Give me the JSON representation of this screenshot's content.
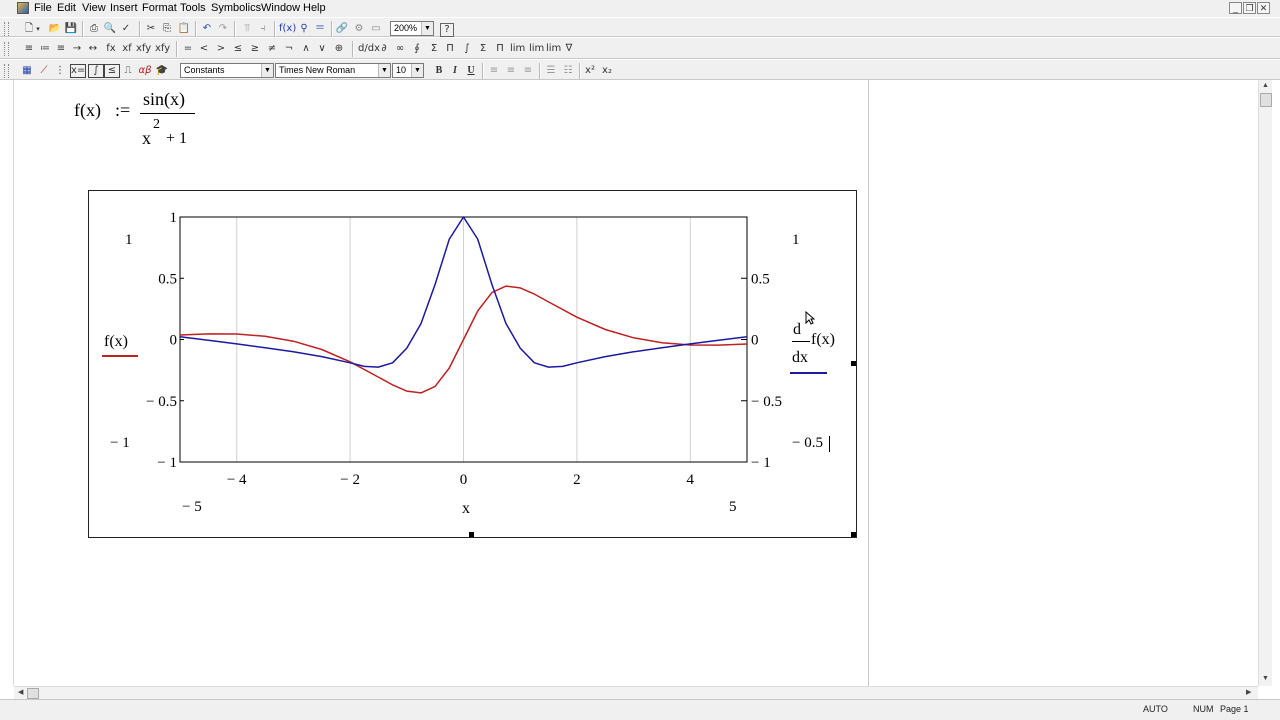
{
  "menu": {
    "items": [
      "File",
      "Edit",
      "View",
      "Insert",
      "Format",
      "Tools",
      "Symbolics",
      "Window",
      "Help"
    ]
  },
  "toolbar": {
    "zoom": "200%",
    "style": "Constants",
    "font": "Times New Roman",
    "size": "10",
    "bold": "B",
    "italic": "I",
    "underline": "U",
    "superscript": "x²",
    "subscript": "x₂"
  },
  "math_toolbar": {
    "symbols": [
      "=",
      "<",
      ">",
      "≤",
      "≥",
      "≠",
      "¬",
      "∧",
      "∨",
      "⊕",
      "∫",
      "Σ",
      "Π",
      "∇"
    ]
  },
  "definition": {
    "lhs": "f(x)",
    "assign": ":=",
    "numerator": "sin(x)",
    "denominator_base": "x",
    "denominator_exp": "2",
    "denominator_rest": "+ 1"
  },
  "plot": {
    "y_axis_top": "1",
    "y_axis_bottom": "− 1",
    "y2_axis_top": "1",
    "y2_axis_bottom": "− 0.5",
    "x_axis_left": "− 5",
    "x_axis_right": "5",
    "x_label": "x",
    "left_trace": "f(x)",
    "right_trace_d": "d",
    "right_trace_dx": "dx",
    "right_trace_f": "f(x)"
  },
  "chart_data": {
    "type": "line",
    "title": "",
    "xlabel": "x",
    "ylabel": "f(x)",
    "y2label": "d/dx f(x)",
    "xlim": [
      -5,
      5
    ],
    "ylim": [
      -1,
      1
    ],
    "y2lim": [
      -1,
      1
    ],
    "x_ticks": [
      "− 4",
      "− 2",
      "0",
      "2",
      "4"
    ],
    "y_ticks": [
      "1",
      "0.5",
      "0",
      "− 0.5",
      "− 1"
    ],
    "y2_ticks": [
      "0.5",
      "0",
      "− 0.5",
      "− 1"
    ],
    "series": [
      {
        "name": "f(x)",
        "color": "#c02020",
        "axis": "left",
        "x": [
          -5,
          -4.5,
          -4,
          -3.5,
          -3,
          -2.5,
          -2,
          -1.5,
          -1.25,
          -1,
          -0.75,
          -0.5,
          -0.25,
          0,
          0.25,
          0.5,
          0.75,
          1,
          1.25,
          1.5,
          2,
          2.5,
          3,
          3.5,
          4,
          4.5,
          5
        ],
        "y": [
          0.037,
          0.046,
          0.045,
          0.026,
          -0.014,
          -0.082,
          -0.182,
          -0.307,
          -0.371,
          -0.421,
          -0.436,
          -0.383,
          -0.233,
          0,
          0.233,
          0.383,
          0.436,
          0.421,
          0.371,
          0.307,
          0.182,
          0.082,
          0.014,
          -0.026,
          -0.045,
          -0.046,
          -0.037
        ]
      },
      {
        "name": "d/dx f(x)",
        "color": "#1a1aa0",
        "axis": "right",
        "x": [
          -5,
          -4.5,
          -4,
          -3.5,
          -3,
          -2.5,
          -2,
          -1.75,
          -1.5,
          -1.25,
          -1,
          -0.75,
          -0.5,
          -0.25,
          0,
          0.25,
          0.5,
          0.75,
          1,
          1.25,
          1.5,
          1.75,
          2,
          2.5,
          3,
          3.5,
          4,
          4.5,
          5
        ],
        "y": [
          0.022,
          -0.006,
          -0.036,
          -0.068,
          -0.1,
          -0.14,
          -0.19,
          -0.22,
          -0.225,
          -0.19,
          -0.07,
          0.13,
          0.45,
          0.82,
          1.0,
          0.82,
          0.45,
          0.13,
          -0.07,
          -0.19,
          -0.225,
          -0.22,
          -0.19,
          -0.14,
          -0.1,
          -0.068,
          -0.036,
          -0.006,
          0.022
        ]
      }
    ]
  },
  "status": {
    "mode": "AUTO",
    "num": "NUM",
    "page": "Page 1"
  }
}
